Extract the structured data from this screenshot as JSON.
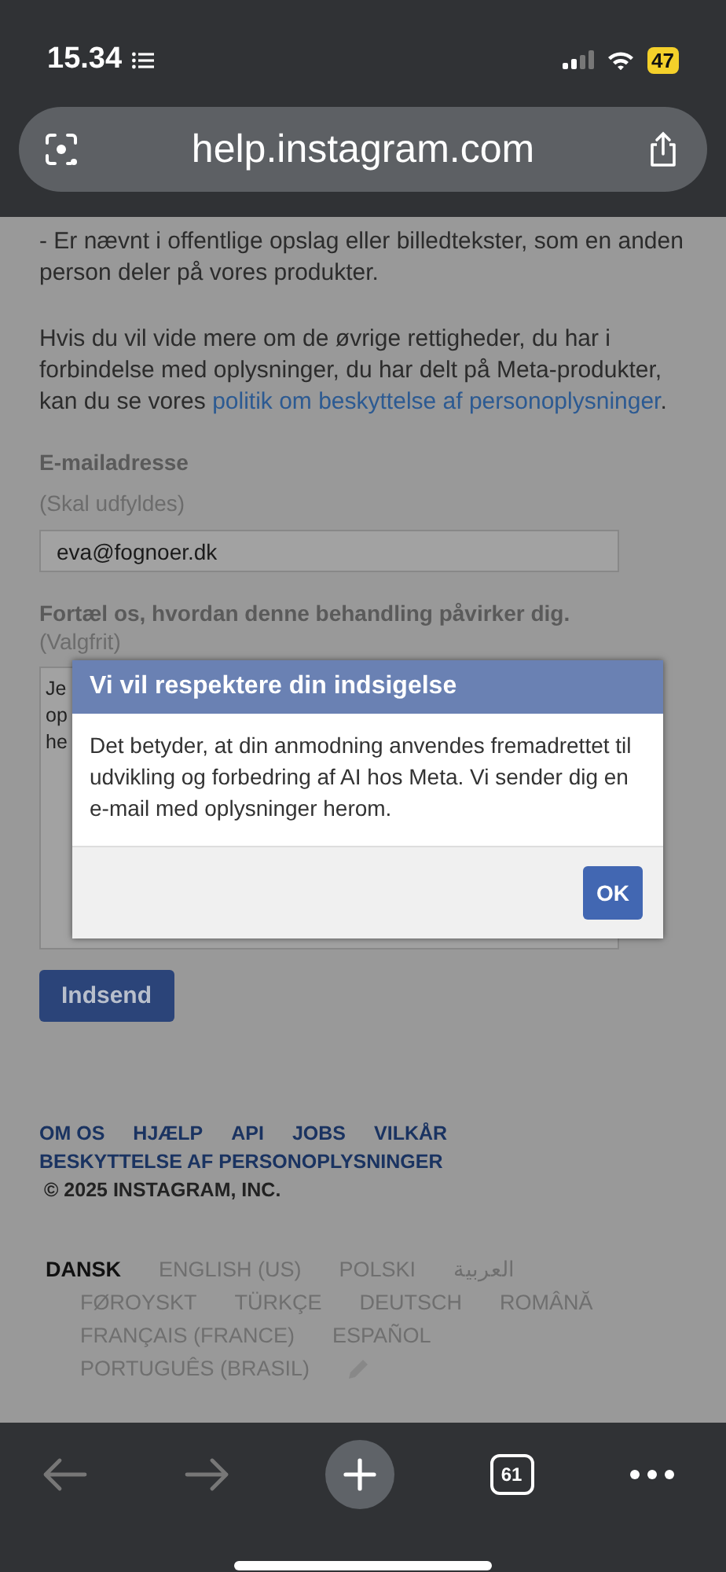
{
  "status_bar": {
    "time": "15.34",
    "battery": "47"
  },
  "address_bar": {
    "url": "help.instagram.com"
  },
  "page": {
    "paragraphs": [
      "- Er nævnt i offentlige opslag eller billedtekster, som en anden person deler på vores produkter.",
      "Hvis du vil vide mere om de øvrige rettigheder, du har i forbindelse med oplysninger, du har delt på Meta-produkter, kan du se vores "
    ],
    "policy_link": "politik om beskyttelse af personoplysninger",
    "link_suffix": ".",
    "email_field": {
      "label": "E-mailadresse",
      "hint": "(Skal udfyldes)",
      "value": "eva@fognoer.dk"
    },
    "impact_field": {
      "label": "Fortæl os, hvordan denne behandling påvirker dig.",
      "hint": "(Valgfrit)",
      "visible_lines": [
        "Je",
        "op",
        "he"
      ]
    },
    "submit_button": "Indsend"
  },
  "dialog": {
    "title": "Vi vil respektere din indsigelse",
    "message": "Det betyder, at din anmodning anvendes fremadrettet til udvikling og forbedring af AI hos Meta. Vi sender dig en e-mail med oplysninger herom.",
    "button": "OK"
  },
  "footer": {
    "links": [
      "OM OS",
      "HJÆLP",
      "API",
      "JOBS",
      "VILKÅR",
      "BESKYTTELSE AF PERSONOPLYSNINGER"
    ],
    "copyright": "© 2025 INSTAGRAM, INC.",
    "languages": [
      {
        "label": "DANSK",
        "selected": true
      },
      {
        "label": "ENGLISH (US)",
        "selected": false
      },
      {
        "label": "POLSKI",
        "selected": false
      },
      {
        "label": "العربية",
        "selected": false
      },
      {
        "label": "FØROYSKT",
        "selected": false
      },
      {
        "label": "TÜRKÇE",
        "selected": false
      },
      {
        "label": "DEUTSCH",
        "selected": false
      },
      {
        "label": "ROMÂNĂ",
        "selected": false
      },
      {
        "label": "FRANÇAIS (FRANCE)",
        "selected": false
      },
      {
        "label": "ESPAÑOL",
        "selected": false
      },
      {
        "label": "PORTUGUÊS (BRASIL)",
        "selected": false
      }
    ]
  },
  "toolbar": {
    "tab_count": "61"
  }
}
